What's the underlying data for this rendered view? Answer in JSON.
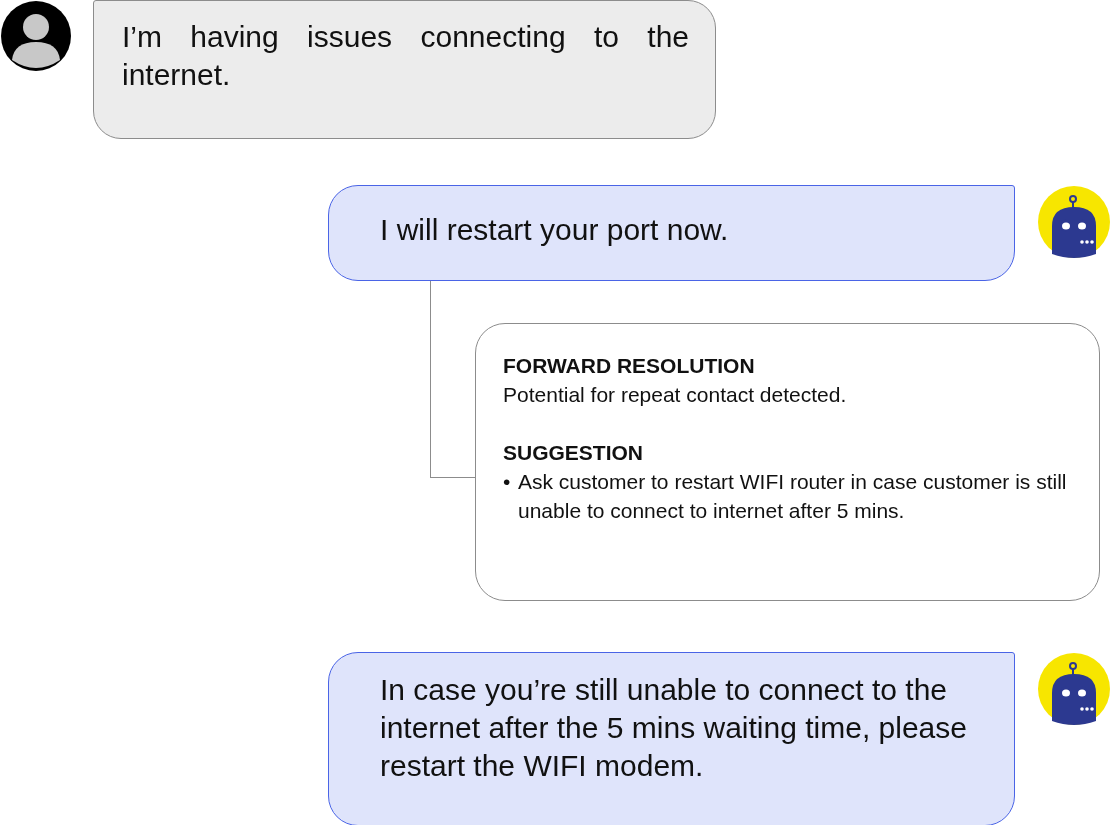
{
  "items": [
    {
      "kind": "user",
      "text": "I’m having issues connecting to the internet."
    },
    {
      "kind": "bot",
      "text": "I will restart your port now."
    },
    {
      "kind": "note",
      "sections": [
        {
          "heading": "FORWARD RESOLUTION",
          "body": "Potential for repeat contact detected."
        },
        {
          "heading": "SUGGESTION",
          "bullets": [
            {
              "marker": "•",
              "text": "Ask customer to restart WIFI router in case customer is still unable to connect to internet after 5 mins."
            }
          ]
        }
      ]
    },
    {
      "kind": "bot",
      "text": "In case you’re still unable to connect to the internet after the 5 mins waiting time, please restart the WIFI modem."
    }
  ]
}
